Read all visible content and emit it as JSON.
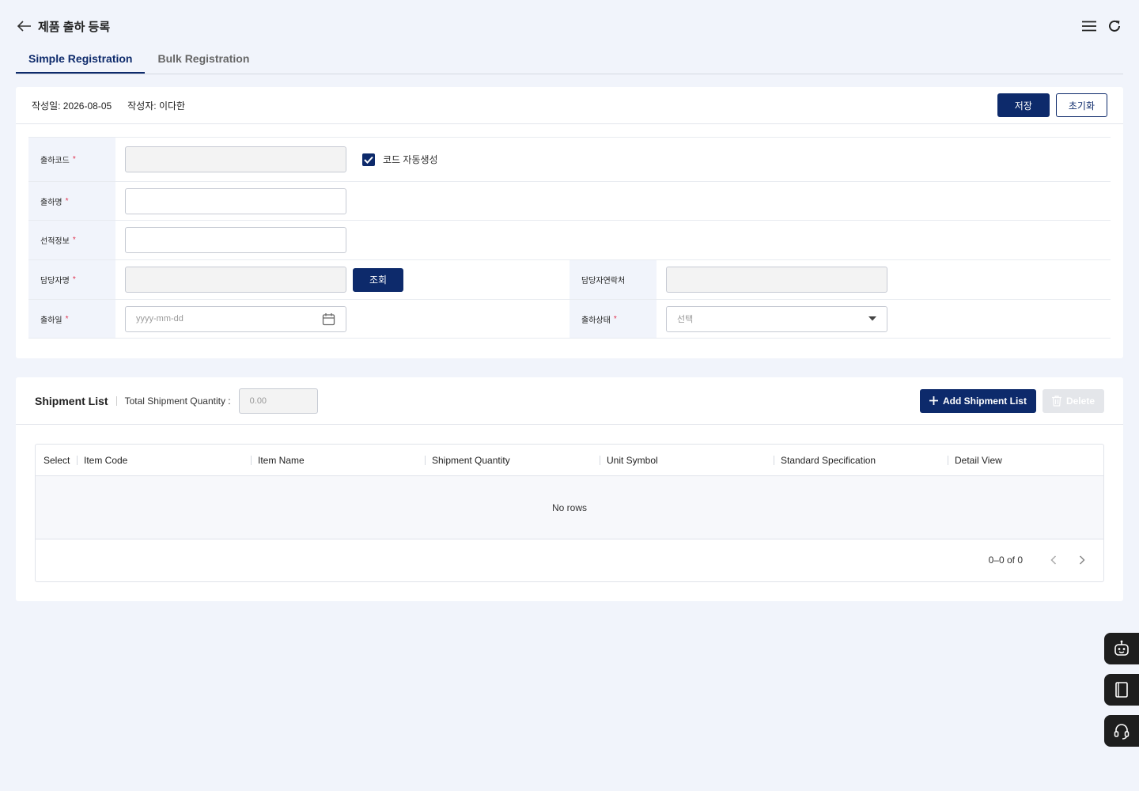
{
  "header": {
    "title": "제품 출하 등록"
  },
  "tabs": [
    {
      "label": "Simple Registration",
      "active": true
    },
    {
      "label": "Bulk Registration",
      "active": false
    }
  ],
  "meta": {
    "created_date": "작성일: 2026-08-05",
    "author": "작성자: 이다한"
  },
  "actions": {
    "save": "저장",
    "reset": "초기화"
  },
  "form": {
    "code_label": "출하코드",
    "auto_code_label": "코드 자동생성",
    "name_label": "출하명",
    "shipping_label": "선적정보",
    "manager_label": "담당자명",
    "search_button": "조회",
    "manager_contact_label": "담당자연락처",
    "date_label": "출하일",
    "date_placeholder": "yyyy-mm-dd",
    "status_label": "출하상태",
    "status_value": "선택",
    "required_mark": "*"
  },
  "shipment": {
    "title": "Shipment List",
    "total_qty_label": "Total Shipment Quantity :",
    "total_qty_value": "0.00",
    "add_button": "Add Shipment List",
    "delete_button": "Delete",
    "columns": [
      "Select",
      "Item Code",
      "Item Name",
      "Shipment Quantity",
      "Unit Symbol",
      "Standard Specification",
      "Detail View"
    ],
    "empty_text": "No rows",
    "pagination": "0–0 of 0"
  },
  "colors": {
    "primary": "#0d2a6b",
    "required": "#e0324f",
    "background": "#f1f4fb"
  }
}
